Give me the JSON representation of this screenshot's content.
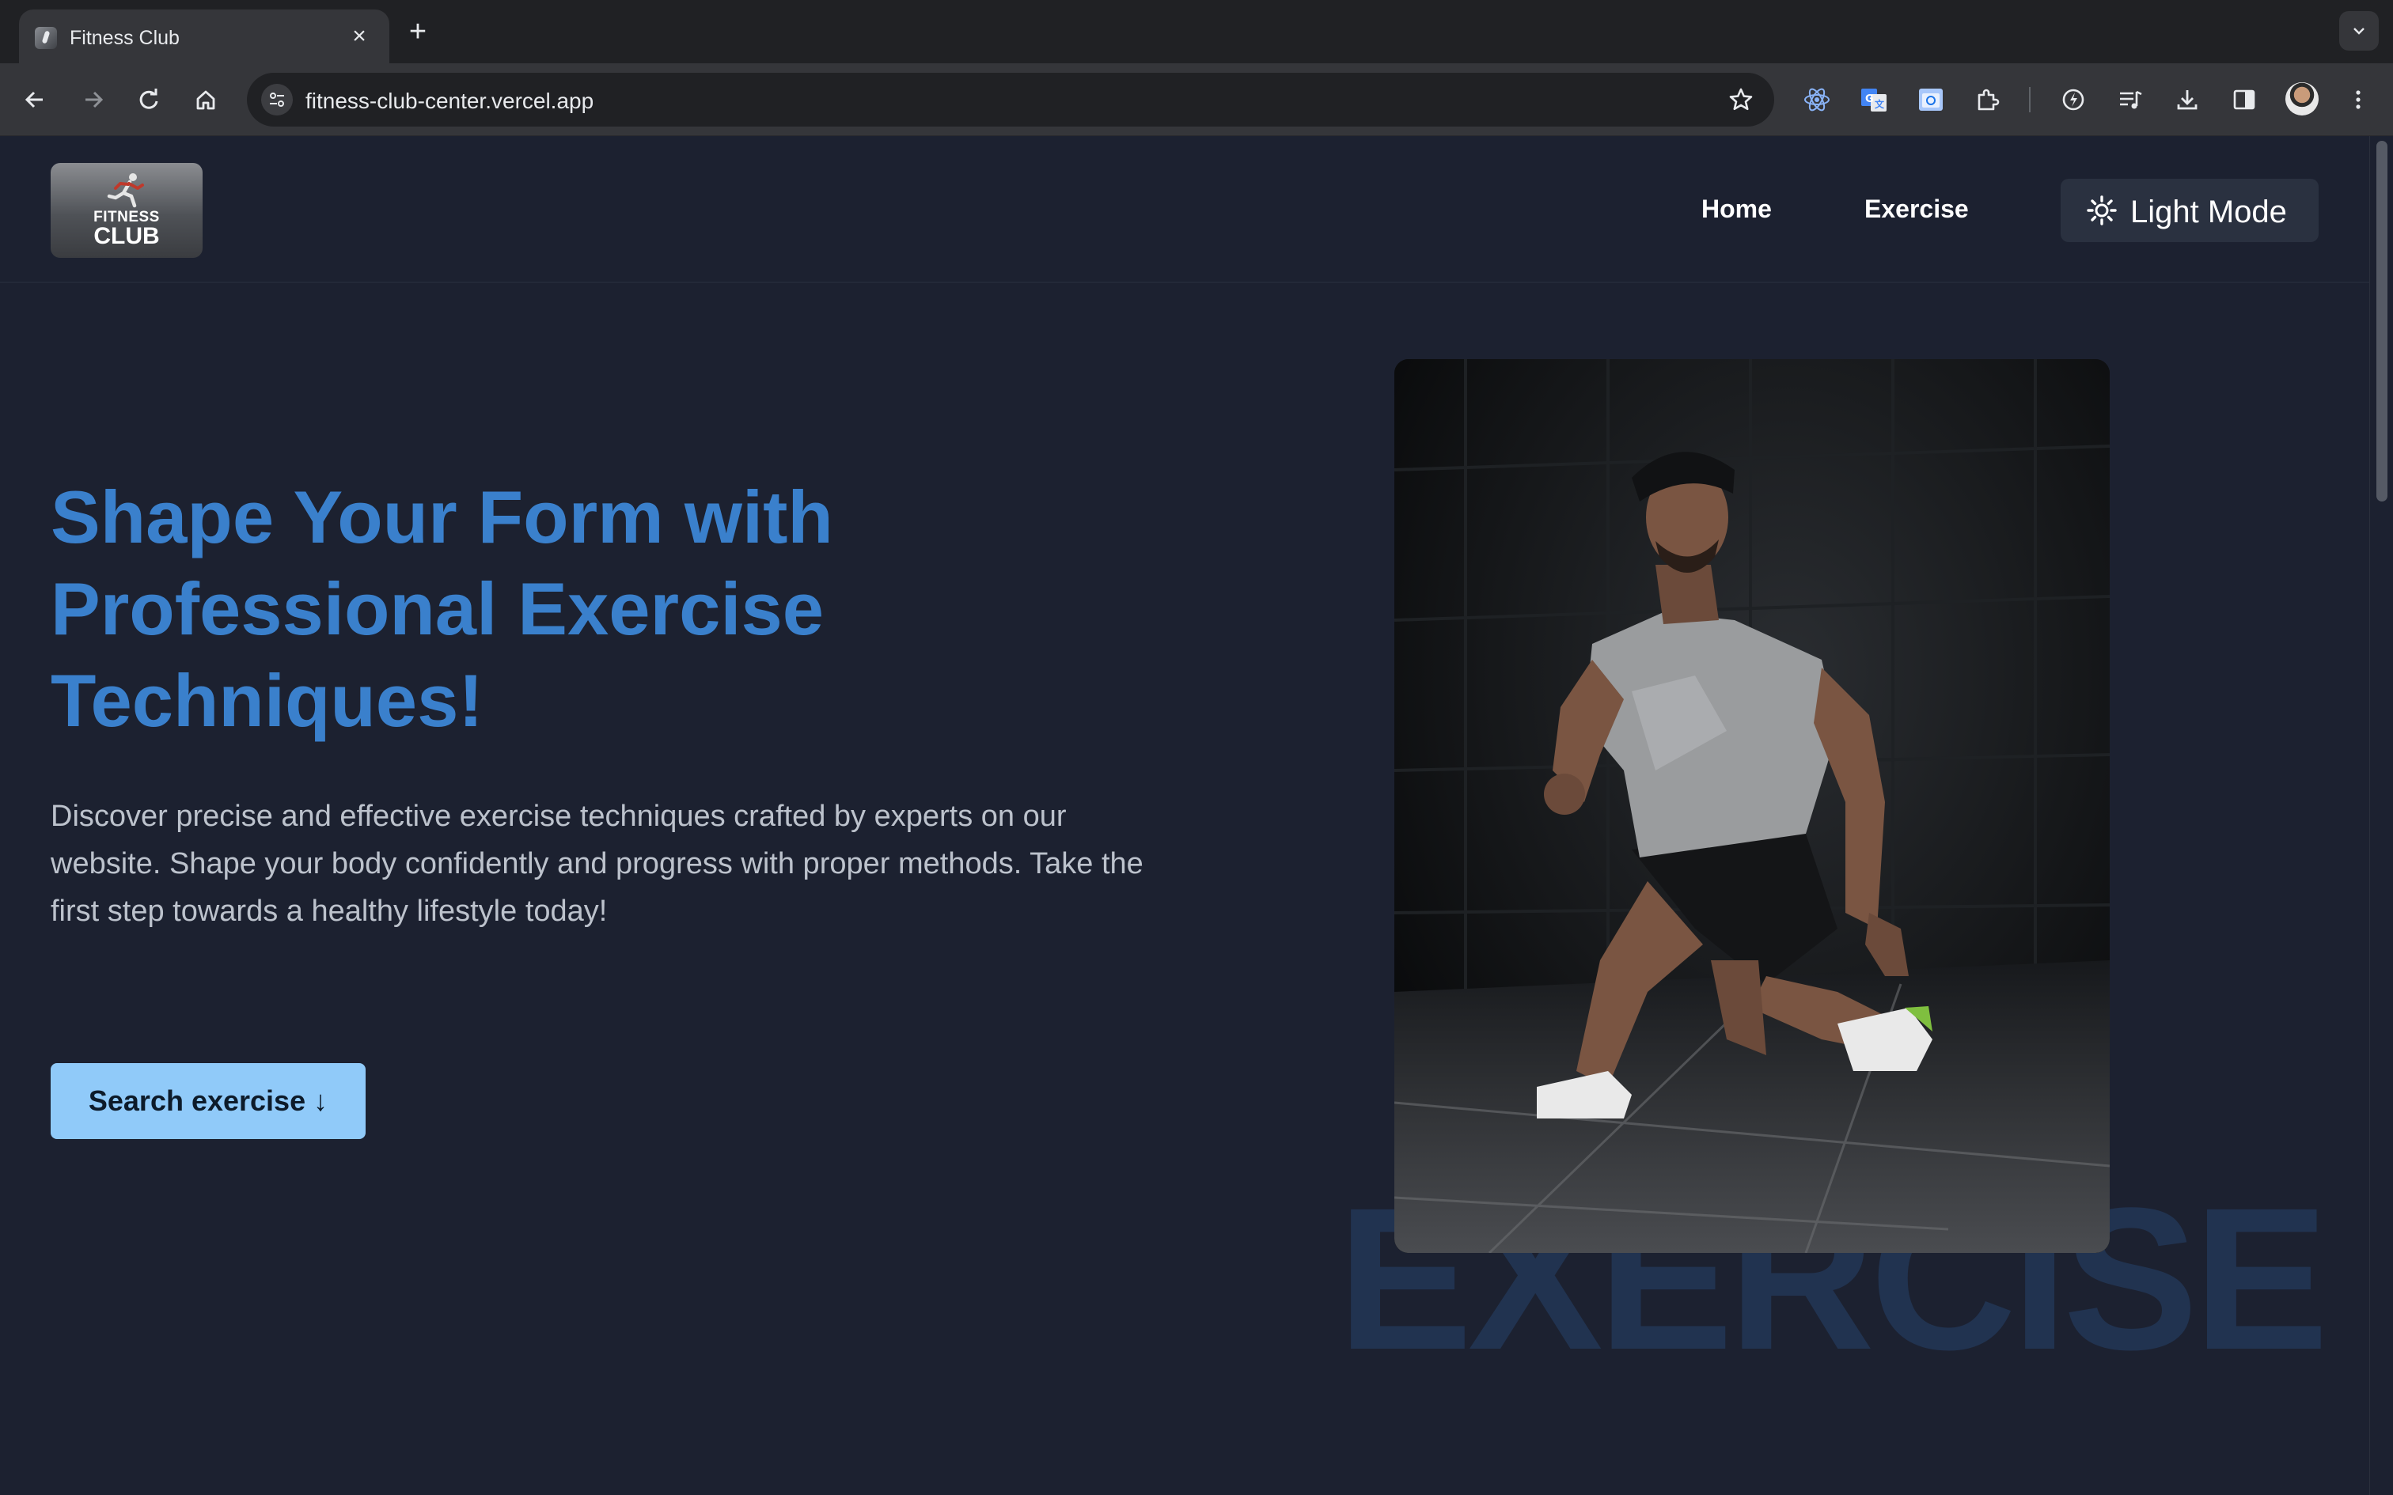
{
  "browser": {
    "tab_title": "Fitness Club",
    "url": "fitness-club-center.vercel.app"
  },
  "site": {
    "logo": {
      "line1": "FITNESS",
      "line2": "CLUB"
    },
    "nav": {
      "home": "Home",
      "exercise": "Exercise"
    },
    "mode_button": "Light Mode",
    "hero": {
      "title": "Shape Your Form with Professional Exercise Techniques!",
      "description": "Discover precise and effective exercise techniques crafted by experts on our website. Shape your body confidently and progress with proper methods. Take the first step towards a healthy lifestyle today!",
      "cta": "Search exercise ↓"
    },
    "watermark": "EXERCISE"
  },
  "colors": {
    "page_bg": "#1c2130",
    "accent_blue": "#3a80cc",
    "cta_bg": "#90caf9",
    "watermark": "#213350"
  },
  "icons": [
    "back-icon",
    "forward-icon",
    "reload-icon",
    "home-icon",
    "site-settings-icon",
    "star-icon",
    "react-devtools-icon",
    "translate-icon",
    "screenshot-icon",
    "extensions-icon",
    "performance-icon",
    "reading-list-icon",
    "download-icon",
    "side-panel-icon",
    "menu-icon",
    "sun-icon"
  ]
}
